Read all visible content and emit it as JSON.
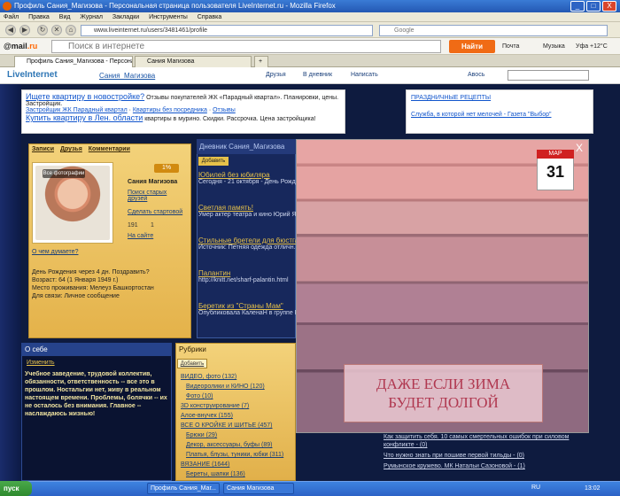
{
  "window": {
    "title": "Профиль Сания_Магизова - Персональная страница пользователя LiveInternet.ru - Mozilla Firefox",
    "min": "_",
    "max": "□",
    "close": "X"
  },
  "menu": [
    "Файл",
    "Правка",
    "Вид",
    "Журнал",
    "Закладки",
    "Инструменты",
    "Справка"
  ],
  "nav": {
    "url": "www.liveinternet.ru/users/3481461/profile",
    "search_placeholder": "Google"
  },
  "mailru": {
    "logo_main": "@mail",
    "logo_suffix": ".ru",
    "search_placeholder": "Поиск в интернете",
    "find_label": "Найти",
    "pochta": "Почта",
    "music": "Музыка",
    "weather": "Уфа +12°C"
  },
  "tabs": [
    {
      "label": "Профиль Сания_Магизова - Персональ..."
    },
    {
      "label": "Сания Магизова"
    }
  ],
  "li": {
    "logo": "LiveInternet",
    "user": "Сания_Магизова",
    "tools": [
      "Друзья",
      "В дневник",
      "Написать",
      "Авось"
    ]
  },
  "ads": {
    "l1": "Ищете квартиру в новостройке?",
    "l1_rest": " Отзывы покупателей ЖК «Парадный квартал». Планировки, цены. Застройщик.",
    "links": [
      "Застройщик ЖК Парадный квартал",
      "Квартиры без посредника",
      "Отзывы"
    ],
    "l2": "Купить квартиру в Лен. области",
    "l2_rest": " квартиры в мурино. Скидки. Рассрочка. Цена застройщика!",
    "r1": "ПРАЗДНИЧНЫЕ РЕЦЕПТЫ",
    "r2": "Служба, в которой нет мелочей - Газета \"Выбор\""
  },
  "profile": {
    "tabs": [
      "Записи",
      "Друзья",
      "Комментарии"
    ],
    "all_photos": "Все фотографии",
    "rating": "1%",
    "name": "Сания Магизова",
    "links": [
      "Поиск старых друзей",
      "Сделать стартовой",
      "На сайте"
    ],
    "counts": [
      "191",
      "1"
    ],
    "think": "О чем думаете?",
    "birthday": "День Рождения через 4 дн. Поздравить?",
    "age": "Возраст: 64 (1 Января 1949 г.)",
    "residence": "Место проживания: Мелеуз Башкортостан",
    "contact": "Для связи: Личное сообщение"
  },
  "diary": {
    "title": "Дневник Сания_Магизова",
    "add": "Добавить",
    "posts": [
      {
        "t": "Юбилей без юбиляра",
        "d": "Сегодня - 21 октября - День Рожд..."
      },
      {
        "t": "Светлая память!",
        "d": "Умер актер театра и кино Юрий Як..."
      },
      {
        "t": "Стильные бретели для бюстга...",
        "d": "Источник: Петняя одежда отличн..."
      },
      {
        "t": "Палантин",
        "d": "http://knitt.net/sharf-palantin.html"
      },
      {
        "t": "Беретик из \"Страны Мам\"",
        "d": "Опубликовала КаленаН в группе В..."
      }
    ]
  },
  "popup": {
    "month": "МАР",
    "day": "31",
    "close": "X",
    "text1": "ДАЖЕ ЕСЛИ ЗИМА",
    "text2": "БУДЕТ ДОЛГОЙ"
  },
  "about": {
    "title": "О себе",
    "edit": "Изменить",
    "text": "Учебное заведение, трудовой коллектив, обязанности, ответственность -- все это в прошлом. Ностальгии нет, живу в реальном настоящем времени. Проблемы, болячки -- их не осталось без внимания. Главное -- наслаждаюсь жизнью!"
  },
  "rubrics": {
    "title": "Рубрики",
    "add": "Добавить",
    "items": [
      "ВИДЕО, фото (132)",
      "Видеоролики и КИНО (120)",
      "Фото (10)",
      "3D конструирование (7)",
      "Алое-внучек (155)",
      "ВСЕ О КРОЙКЕ И ШИТЬЕ (457)",
      "Брюки (29)",
      "Декор, аксессуары, буфы (89)",
      "Платья, блузы, туники, юбки (311)",
      "ВЯЗАНИЕ (1644)",
      "Береты, шапки (136)"
    ]
  },
  "right_list": [
    "Как защитить себя. 10 самых смертельных ошибок при силовом конфликте - (0)",
    "Что нужно знать при пошиве первой тильды - (0)",
    "Румынское кружево. МК Натальи Сазоновой - (1)"
  ],
  "taskbar": {
    "start": "пуск",
    "items": [
      "Профиль Сания_Маг...",
      "Сания Магизова"
    ],
    "lang": "RU",
    "clock": "13:02"
  }
}
